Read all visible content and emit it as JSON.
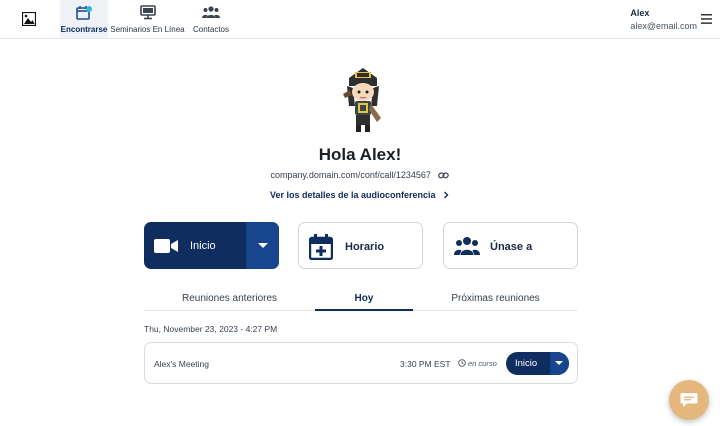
{
  "nav": {
    "items": [
      {
        "label": "Encontrarse",
        "icon": "calendar-video-icon",
        "active": true
      },
      {
        "label": "Seminarios En Línea",
        "icon": "monitor-icon",
        "active": false
      },
      {
        "label": "Contactos",
        "icon": "people-icon",
        "active": false
      }
    ]
  },
  "user": {
    "name": "Alex",
    "email": "alex@email.com"
  },
  "hero": {
    "greeting": "Hola Alex!",
    "conference_url": "company.domain.com/conf/call/1234567",
    "details_link": "Ver los detalles de la audioconferencia"
  },
  "actions": {
    "start": "Inicio",
    "schedule": "Horario",
    "join": "Únase a"
  },
  "tabs": [
    "Reuniones anteriores",
    "Hoy",
    "Próximas reuniones"
  ],
  "active_tab": "Hoy",
  "date_label": "Thu, November 23, 2023 - 4:27 PM",
  "meeting": {
    "name": "Alex's Meeting",
    "time": "3:30 PM EST",
    "status": "en curso",
    "button": "Inicio"
  },
  "colors": {
    "primary": "#0f2d5e",
    "primary_light": "#17468f",
    "chat_fab": "#e6b77d"
  }
}
